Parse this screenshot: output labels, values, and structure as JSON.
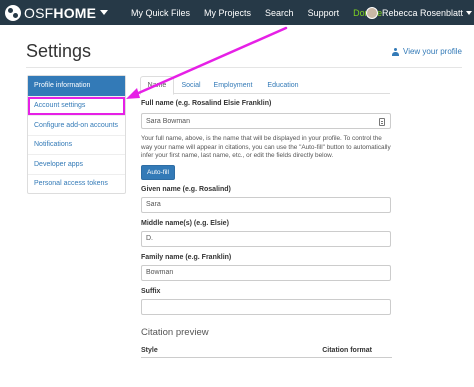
{
  "navbar": {
    "logo_prefix": "OSF",
    "logo_bold": "HOME",
    "links": [
      {
        "label": "My Quick Files"
      },
      {
        "label": "My Projects"
      },
      {
        "label": "Search"
      },
      {
        "label": "Support"
      },
      {
        "label": "Donate"
      }
    ],
    "user_name": "Rebecca Rosenblatt"
  },
  "page": {
    "title": "Settings",
    "view_profile": "View your profile"
  },
  "sidebar": {
    "items": [
      {
        "label": "Profile information",
        "active": true
      },
      {
        "label": "Account settings",
        "highlighted": true
      },
      {
        "label": "Configure add-on accounts"
      },
      {
        "label": "Notifications"
      },
      {
        "label": "Developer apps"
      },
      {
        "label": "Personal access tokens"
      }
    ]
  },
  "tabs": [
    {
      "label": "Name",
      "active": true
    },
    {
      "label": "Social"
    },
    {
      "label": "Employment"
    },
    {
      "label": "Education"
    }
  ],
  "form": {
    "full_name_label": "Full name (e.g. Rosalind Elsie Franklin)",
    "full_name_value": "Sara Bowman",
    "help_text": "Your full name, above, is the name that will be displayed in your profile. To control the way your name will appear in citations, you can use the \"Auto-fill\" button to automatically infer your first name, last name, etc., or edit the fields directly below.",
    "autofill_label": "Auto-fill",
    "given_label": "Given name (e.g. Rosalind)",
    "given_value": "Sara",
    "middle_label": "Middle name(s) (e.g. Elsie)",
    "middle_value": "D.",
    "family_label": "Family name (e.g. Franklin)",
    "family_value": "Bowman",
    "suffix_label": "Suffix",
    "suffix_value": ""
  },
  "citation": {
    "title": "Citation preview",
    "col_style": "Style",
    "col_format": "Citation format"
  },
  "colors": {
    "navbar_bg": "#263947",
    "primary": "#337ab7",
    "donate": "#7ed321",
    "annotation": "#e620e6"
  }
}
